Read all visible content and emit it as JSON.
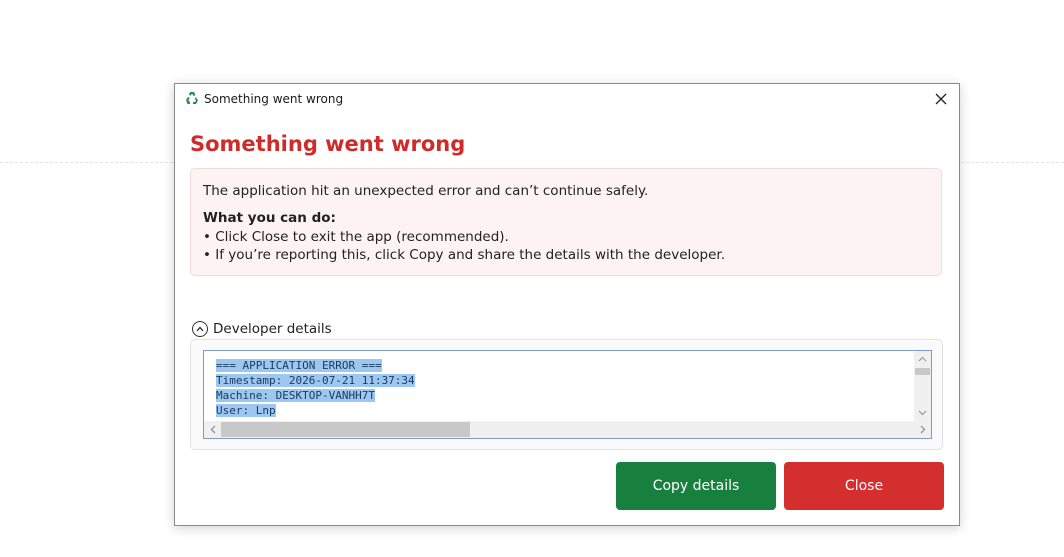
{
  "window": {
    "title": "Something went wrong",
    "icon": "recycle-app-icon"
  },
  "dialog": {
    "heading": "Something went wrong",
    "message": "The application hit an unexpected error and can’t continue safely.",
    "what_heading": "What you can do:",
    "bullets": [
      "• Click Close to exit the app (recommended).",
      "• If you’re reporting this, click Copy and share the details with the developer."
    ]
  },
  "developer": {
    "toggle_label": "Developer details",
    "expanded": true,
    "log_lines": [
      "=== APPLICATION ERROR ===",
      "Timestamp: 2026-07-21 11:37:34",
      "Machine: DESKTOP-VANHH7T",
      "User: Lnp"
    ]
  },
  "buttons": {
    "copy_label": "Copy details",
    "close_label": "Close"
  },
  "colors": {
    "heading": "#d02b2b",
    "copy_button": "#18803e",
    "close_button": "#d42e2e",
    "info_background": "#fdf3f3",
    "selection": "#9cc7f0"
  }
}
